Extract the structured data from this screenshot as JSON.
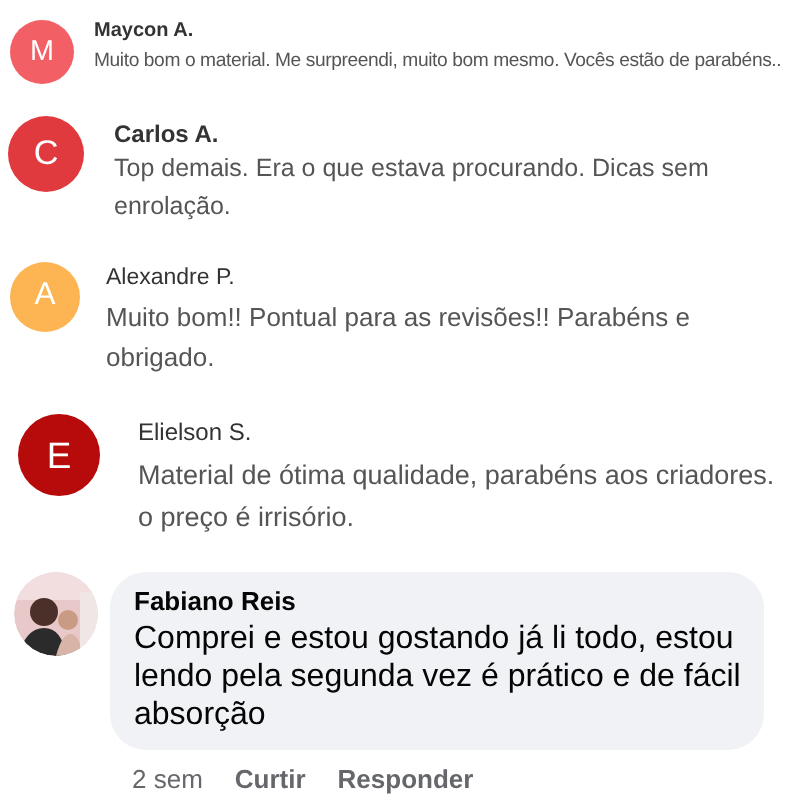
{
  "comments": [
    {
      "kind": "letter",
      "initial": "M",
      "color": "#f26065",
      "name": "Maycon A.",
      "text": "Muito bom o material. Me surpreendi, muito bom mesmo. Vocês estão de parabéns.."
    },
    {
      "kind": "letter",
      "initial": "C",
      "color": "#e03a3e",
      "name": "Carlos A.",
      "text": "Top demais. Era o que estava procurando. Dicas sem enrolação."
    },
    {
      "kind": "letter",
      "initial": "A",
      "color": "#fdb452",
      "name": "Alexandre P.",
      "text": "Muito bom!! Pontual para as revisões!! Parabéns e obrigado."
    },
    {
      "kind": "letter",
      "initial": "E",
      "color": "#b70a0a",
      "name": "Elielson S.",
      "text": "Material de ótima qualidade, parabéns aos criadores.\no preço é irrisório."
    },
    {
      "name": "Fabiano Reis",
      "text": "Comprei e estou gostando já li todo, estou lendo pela segunda vez é prático e de fácil absorção",
      "actions": [
        "2 sem",
        "Curtir",
        "Responder"
      ]
    }
  ]
}
